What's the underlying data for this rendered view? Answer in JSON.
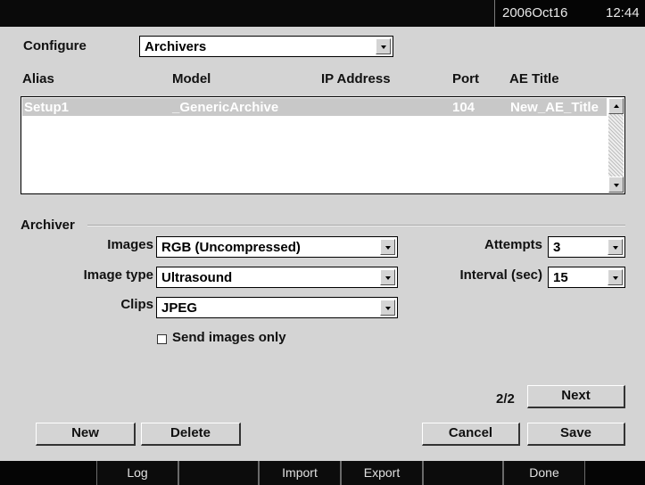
{
  "topbar": {
    "date": "2006Oct16",
    "time": "12:44"
  },
  "configure": {
    "label": "Configure",
    "value": "Archivers"
  },
  "list": {
    "columns": [
      "Alias",
      "Model",
      "IP Address",
      "Port",
      "AE Title"
    ],
    "rows": [
      {
        "alias": "Setup1",
        "model": "_GenericArchive",
        "ip": "",
        "port": "104",
        "ae_title": "New_AE_Title"
      }
    ]
  },
  "archiver": {
    "section_label": "Archiver",
    "images": {
      "label": "Images",
      "value": "RGB (Uncompressed)"
    },
    "image_type": {
      "label": "Image type",
      "value": "Ultrasound"
    },
    "clips": {
      "label": "Clips",
      "value": "JPEG"
    },
    "send_images_only": {
      "label": "Send images only",
      "checked": false
    },
    "attempts": {
      "label": "Attempts",
      "value": "3"
    },
    "interval": {
      "label": "Interval (sec)",
      "value": "15"
    }
  },
  "paging": {
    "page": "2/2",
    "next": "Next"
  },
  "buttons": {
    "new": "New",
    "delete": "Delete",
    "cancel": "Cancel",
    "save": "Save"
  },
  "bottombar": {
    "log": "Log",
    "import": "Import",
    "export": "Export",
    "done": "Done"
  }
}
